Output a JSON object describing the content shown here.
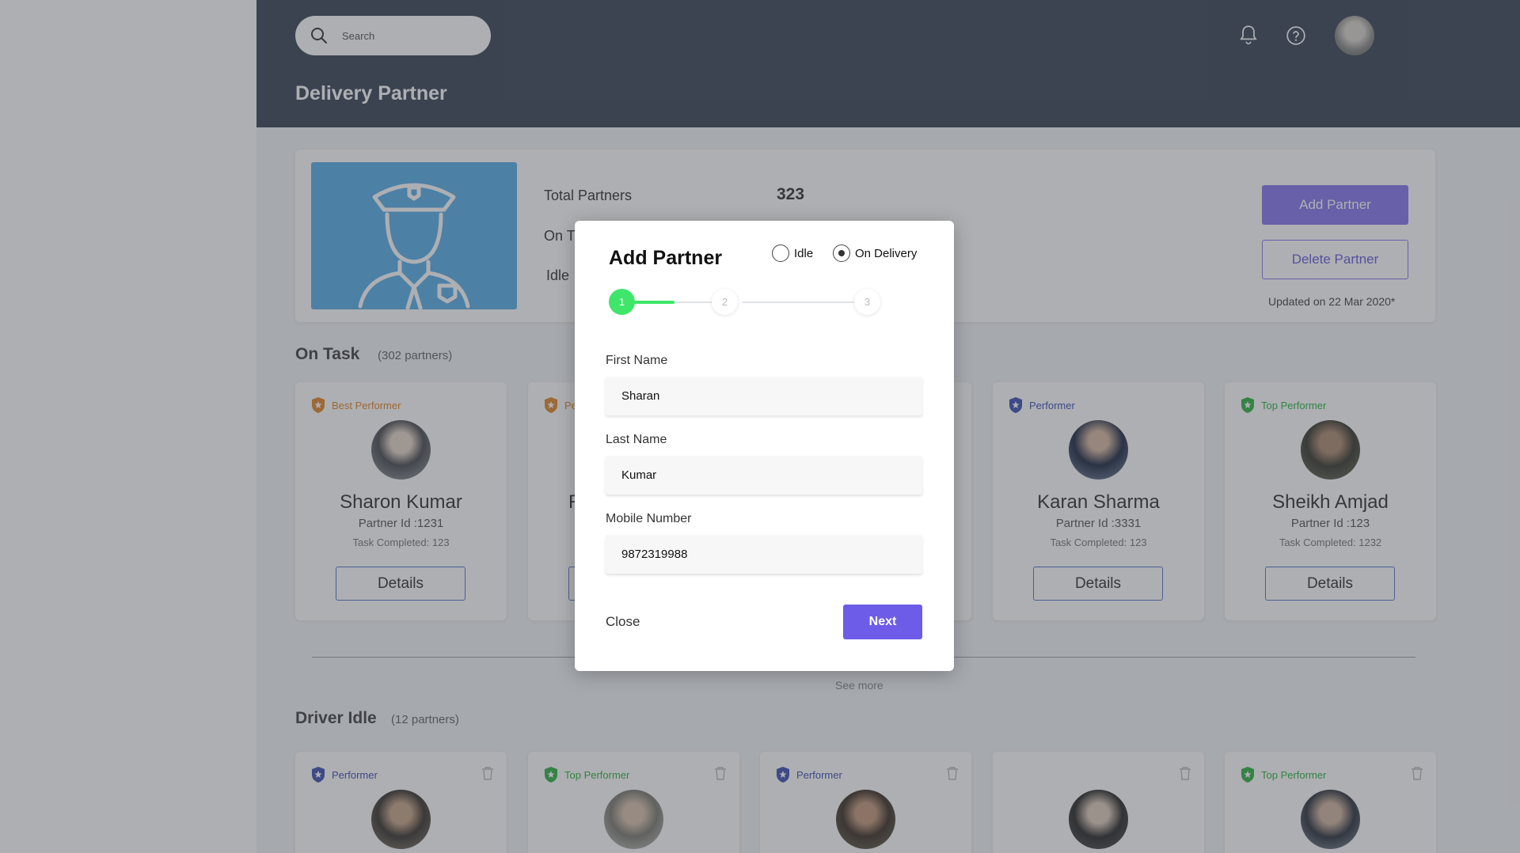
{
  "header": {
    "search_placeholder": "Search",
    "page_title": "Delivery Partner",
    "icons": [
      "bell-icon",
      "help-icon",
      "user-avatar"
    ]
  },
  "summary": {
    "total_label": "Total Partners",
    "total_value": "323",
    "on_task_label_visible": "On T",
    "idle_label_visible": "Idle",
    "add_button": "Add Partner",
    "delete_button": "Delete Partner",
    "updated": "Updated on 22 Mar 2020*"
  },
  "on_task": {
    "title": "On Task",
    "count": "(302 partners)",
    "cards": [
      {
        "badge": "Best Performer",
        "badge_color": "#e2872a",
        "name": "Sharon Kumar",
        "id": "Partner Id :1231",
        "tasks": "Task Completed: 123",
        "button": "Details"
      },
      {
        "badge": "Pe",
        "badge_color": "#e2872a",
        "name": "R",
        "id": "",
        "tasks": "",
        "button": ""
      },
      {
        "badge": "Performer",
        "badge_color": "#3f51b5",
        "name": "Karan Sharma",
        "id": "Partner Id :3331",
        "tasks": "Task Completed: 123",
        "button": "Details"
      },
      {
        "badge": "Top Performer",
        "badge_color": "#2fb344",
        "name": "Sheikh Amjad",
        "id": "Partner Id :123",
        "tasks": "Task Completed: 1232",
        "button": "Details"
      }
    ]
  },
  "see_more": "See more",
  "driver_idle": {
    "title": "Driver Idle",
    "count": "(12 partners)",
    "cards": [
      {
        "badge": "Performer",
        "badge_color": "#3f51b5"
      },
      {
        "badge": "Top Performer",
        "badge_color": "#2fb344"
      },
      {
        "badge": "Performer",
        "badge_color": "#3f51b5"
      },
      {
        "badge": "",
        "badge_color": ""
      },
      {
        "badge": "Top Performer",
        "badge_color": "#2fb344"
      }
    ]
  },
  "modal": {
    "title": "Add Partner",
    "radio_idle": "Idle",
    "radio_on_delivery": "On Delivery",
    "selected_status": "On Delivery",
    "steps": [
      "1",
      "2",
      "3"
    ],
    "current_step": 1,
    "first_name_label": "First Name",
    "first_name_value": "Sharan",
    "last_name_label": "Last Name",
    "last_name_value": "Kumar",
    "mobile_label": "Mobile Number",
    "mobile_value": "9872319988",
    "close_label": "Close",
    "next_label": "Next",
    "accent_color": "#6c5ce7",
    "step_active_color": "#3ee66a"
  }
}
